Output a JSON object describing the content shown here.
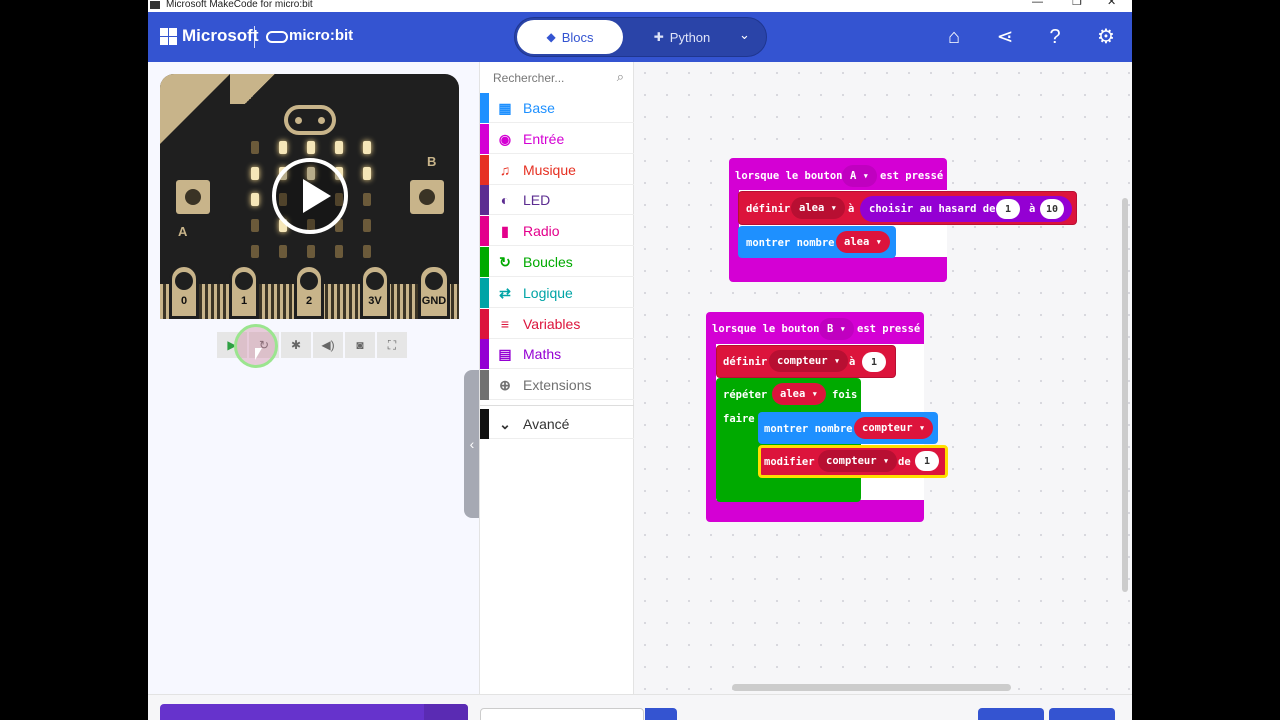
{
  "window": {
    "title": "Microsoft MakeCode for micro:bit",
    "controls": [
      "—",
      "❐",
      "✕"
    ]
  },
  "header": {
    "brand": "Microsoft",
    "product": "micro:bit",
    "tabs": [
      {
        "label": "Blocs",
        "icon": "puzzle-icon"
      },
      {
        "label": "Python",
        "icon": "python-icon"
      }
    ],
    "active_tab": "Blocs",
    "icons": [
      "home-icon",
      "share-icon",
      "help-icon",
      "settings-icon"
    ]
  },
  "simulator": {
    "pins": [
      "0",
      "1",
      "2",
      "3V",
      "GND"
    ],
    "button_a": "A",
    "button_b": "B",
    "toolbar": [
      "play-icon",
      "restart-icon",
      "debug-icon",
      "sound-icon",
      "screenshot-icon",
      "fullscreen-icon"
    ],
    "leds_on": [
      [
        1,
        0
      ],
      [
        2,
        0
      ],
      [
        3,
        0
      ],
      [
        4,
        0
      ],
      [
        0,
        1
      ],
      [
        1,
        1
      ],
      [
        2,
        1
      ],
      [
        3,
        1
      ],
      [
        4,
        1
      ],
      [
        1,
        3
      ],
      [
        0,
        2
      ]
    ]
  },
  "toolbox": {
    "search_placeholder": "Rechercher...",
    "categories": [
      {
        "label": "Base",
        "color": "#1e90ff",
        "icon": "grid-icon"
      },
      {
        "label": "Entrée",
        "color": "#d400d4",
        "icon": "target-icon"
      },
      {
        "label": "Musique",
        "color": "#e63022",
        "icon": "headphones-icon"
      },
      {
        "label": "LED",
        "color": "#5c2d91",
        "icon": "toggle-icon"
      },
      {
        "label": "Radio",
        "color": "#e3008c",
        "icon": "signal-icon"
      },
      {
        "label": "Boucles",
        "color": "#00aa00",
        "icon": "loop-icon"
      },
      {
        "label": "Logique",
        "color": "#00a4a6",
        "icon": "shuffle-icon"
      },
      {
        "label": "Variables",
        "color": "#dc143c",
        "icon": "list-icon"
      },
      {
        "label": "Maths",
        "color": "#9400d3",
        "icon": "calculator-icon"
      },
      {
        "label": "Extensions",
        "color": "#717171",
        "icon": "plus-circle-icon"
      }
    ],
    "advanced": "Avancé"
  },
  "workspace": {
    "event_a": {
      "label": "lorsque le bouton",
      "button": "A",
      "suffix": "est pressé"
    },
    "set_alea": {
      "label": "définir",
      "var": "alea",
      "to": "à",
      "rand_label": "choisir au hasard de",
      "from": "1",
      "to_word": "à",
      "to_val": "10"
    },
    "show_alea": {
      "label": "montrer nombre",
      "var": "alea"
    },
    "event_b": {
      "label": "lorsque le bouton",
      "button": "B",
      "suffix": "est pressé"
    },
    "set_compteur": {
      "label": "définir",
      "var": "compteur",
      "to": "à",
      "value": "1"
    },
    "repeat": {
      "label": "répéter",
      "var": "alea",
      "suffix": "fois",
      "do": "faire"
    },
    "show_compteur": {
      "label": "montrer nombre",
      "var": "compteur"
    },
    "change": {
      "label": "modifier",
      "var": "compteur",
      "by": "de",
      "value": "1"
    },
    "colors": {
      "input": "#d400d4",
      "variables": "#dc143c",
      "basic": "#1e90ff",
      "loops": "#00aa00",
      "math": "#9400d3"
    }
  }
}
